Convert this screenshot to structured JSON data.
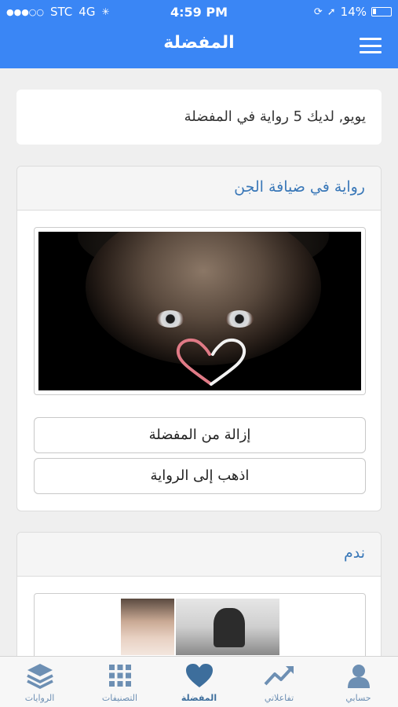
{
  "status_bar": {
    "signal": "●●●○○",
    "carrier": "STC",
    "network": "4G",
    "time": "4:59 PM",
    "battery": "14%"
  },
  "nav": {
    "title": "المفضلة",
    "menu_icon": "hamburger-menu-icon"
  },
  "summary": {
    "text": "يويو, لديك 5 رواية في المفضلة"
  },
  "favorites": [
    {
      "title": "رواية في ضيافة الجن",
      "remove_label": "إزالة من المفضلة",
      "go_label": "اذهب إلى الرواية"
    },
    {
      "title": "ندم"
    }
  ],
  "tabs": [
    {
      "label": "حسابي",
      "icon": "user-icon"
    },
    {
      "label": "تفاعلاتي",
      "icon": "trending-icon"
    },
    {
      "label": "المفضلة",
      "icon": "heart-icon",
      "active": true
    },
    {
      "label": "التصنيفات",
      "icon": "grid-icon"
    },
    {
      "label": "الروايات",
      "icon": "layers-icon"
    }
  ],
  "colors": {
    "primary": "#3a86f5",
    "link": "#3a78b8",
    "tab_icon": "#6d8fb3"
  }
}
